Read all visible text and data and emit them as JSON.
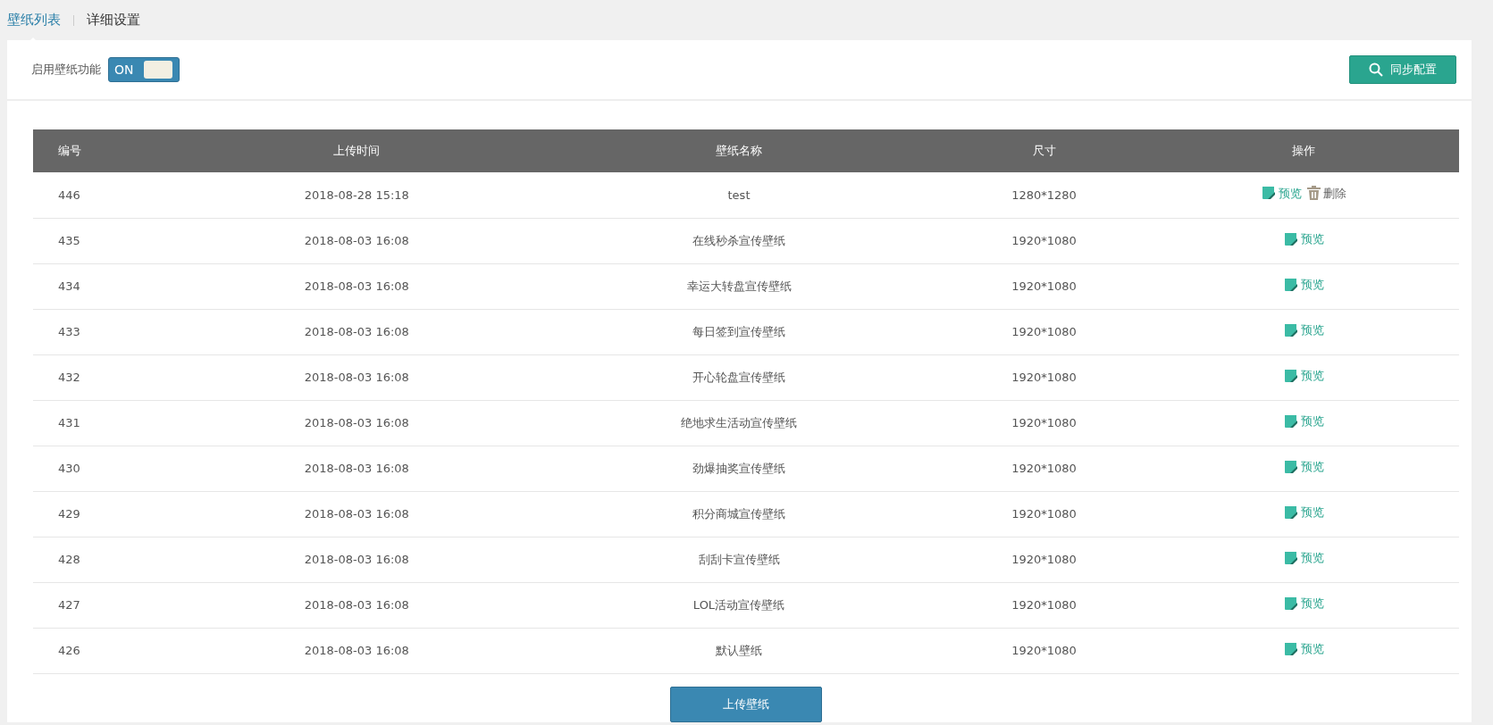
{
  "tabs": [
    {
      "label": "壁纸列表",
      "selected": true
    },
    {
      "label": "详细设置",
      "selected": false
    }
  ],
  "toggle": {
    "label": "启用壁纸功能",
    "on": true,
    "state_text": "ON"
  },
  "sync_button": {
    "label": "同步配置"
  },
  "table": {
    "columns": [
      "编号",
      "上传时间",
      "壁纸名称",
      "尺寸",
      "操作"
    ],
    "rows": [
      {
        "id": "446",
        "time": "2018-08-28 15:18",
        "name": "test",
        "size": "1280*1280",
        "actions": [
          {
            "kind": "preview",
            "label": "预览"
          },
          {
            "kind": "delete",
            "label": "删除"
          }
        ]
      },
      {
        "id": "435",
        "time": "2018-08-03 16:08",
        "name": "在线秒杀宣传壁纸",
        "size": "1920*1080",
        "actions": [
          {
            "kind": "preview",
            "label": "预览"
          }
        ]
      },
      {
        "id": "434",
        "time": "2018-08-03 16:08",
        "name": "幸运大转盘宣传壁纸",
        "size": "1920*1080",
        "actions": [
          {
            "kind": "preview",
            "label": "预览"
          }
        ]
      },
      {
        "id": "433",
        "time": "2018-08-03 16:08",
        "name": "每日签到宣传壁纸",
        "size": "1920*1080",
        "actions": [
          {
            "kind": "preview",
            "label": "预览"
          }
        ]
      },
      {
        "id": "432",
        "time": "2018-08-03 16:08",
        "name": "开心轮盘宣传壁纸",
        "size": "1920*1080",
        "actions": [
          {
            "kind": "preview",
            "label": "预览"
          }
        ]
      },
      {
        "id": "431",
        "time": "2018-08-03 16:08",
        "name": "绝地求生活动宣传壁纸",
        "size": "1920*1080",
        "actions": [
          {
            "kind": "preview",
            "label": "预览"
          }
        ]
      },
      {
        "id": "430",
        "time": "2018-08-03 16:08",
        "name": "劲爆抽奖宣传壁纸",
        "size": "1920*1080",
        "actions": [
          {
            "kind": "preview",
            "label": "预览"
          }
        ]
      },
      {
        "id": "429",
        "time": "2018-08-03 16:08",
        "name": "积分商城宣传壁纸",
        "size": "1920*1080",
        "actions": [
          {
            "kind": "preview",
            "label": "预览"
          }
        ]
      },
      {
        "id": "428",
        "time": "2018-08-03 16:08",
        "name": "刮刮卡宣传壁纸",
        "size": "1920*1080",
        "actions": [
          {
            "kind": "preview",
            "label": "预览"
          }
        ]
      },
      {
        "id": "427",
        "time": "2018-08-03 16:08",
        "name": "LOL活动宣传壁纸",
        "size": "1920*1080",
        "actions": [
          {
            "kind": "preview",
            "label": "预览"
          }
        ]
      },
      {
        "id": "426",
        "time": "2018-08-03 16:08",
        "name": "默认壁纸",
        "size": "1920*1080",
        "actions": [
          {
            "kind": "preview",
            "label": "预览"
          }
        ]
      }
    ]
  },
  "upload_button": {
    "label": "上传壁纸"
  }
}
